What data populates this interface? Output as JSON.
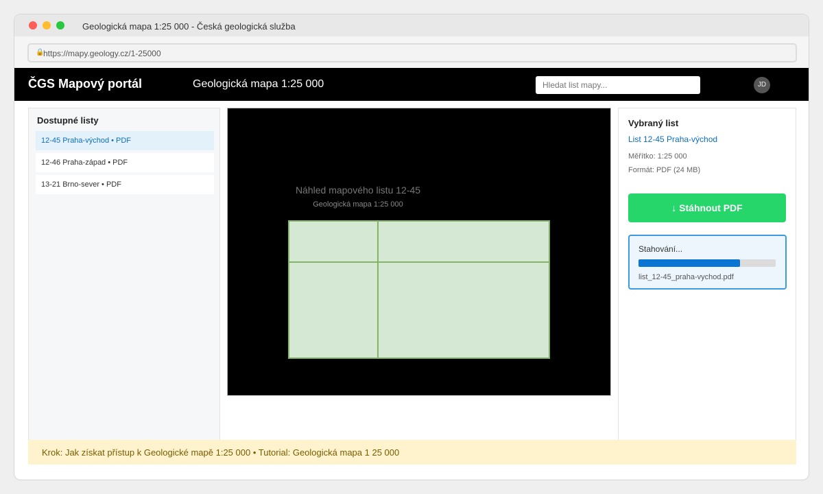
{
  "window": {
    "title": "Geologická mapa 1:25 000 - Česká geologická služba"
  },
  "browser": {
    "url": "https://mapy.geology.cz/1-25000",
    "lock_icon": "lock-icon"
  },
  "appbar": {
    "brand": "ČGS Mapový portál",
    "title": "Geologická mapa 1:25 000",
    "search_placeholder": "Hledat list mapy...",
    "avatar_initials": "JD"
  },
  "sidebar": {
    "title": "Dostupné listy",
    "items": [
      {
        "label": "12-45 Praha-východ • PDF",
        "selected": true
      },
      {
        "label": "12-46 Praha-západ • PDF",
        "selected": false
      },
      {
        "label": "13-21 Brno-sever • PDF",
        "selected": false
      }
    ]
  },
  "preview": {
    "title": "Náhled mapového listu 12-45",
    "subtitle": "Geologická mapa 1:25 000"
  },
  "detail": {
    "title": "Vybraný list",
    "link": "List 12-45 Praha-východ",
    "scale": "Měřítko: 1:25 000",
    "format": "Formát: PDF (24 MB)",
    "download_button": "↓ Stáhnout PDF",
    "progress_label": "Stahování...",
    "progress_fraction": 0.74,
    "progress_file": "list_12-45_praha-vychod.pdf"
  },
  "footer": {
    "text": "Krok: Jak získat přístup k Geologické mapě 1:25 000 • Tutorial: Geologická mapa 1 25 000"
  },
  "colors": {
    "accent": "#0d6ebd",
    "download": "#26d66b",
    "progress": "#0b75d3",
    "map_fill": "#d5e8d4",
    "map_stroke": "#82b366",
    "footer_bg": "#fff3cd"
  }
}
